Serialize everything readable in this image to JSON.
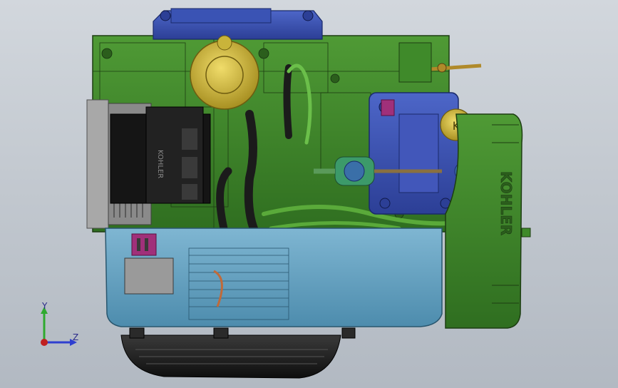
{
  "viewport": {
    "background_top": "#d2d7dd",
    "background_bottom": "#b2b9c2"
  },
  "model": {
    "brand_text_side": "KOHLER",
    "brand_text_block": "KOHLER",
    "filler_cap_letter": "K",
    "colors": {
      "housing_green": "#3f8a2a",
      "dark_green": "#2b5e1c",
      "top_cover_blue": "#3d57b8",
      "sump_teal": "#6aa6c4",
      "sump_dark": "#3f7fa0",
      "shroud_black": "#1c1c1c",
      "oil_cap_yellow": "#c9b43a",
      "filter_purple": "#5a57b5",
      "magenta_part": "#a0307a",
      "grey_part": "#9a9a9a",
      "brass": "#b08a2a"
    }
  },
  "triad": {
    "y_label": "Y",
    "z_label": "Z",
    "y_color": "#2faa2f",
    "z_color": "#2f3fd0",
    "x_color": "#c02020"
  }
}
